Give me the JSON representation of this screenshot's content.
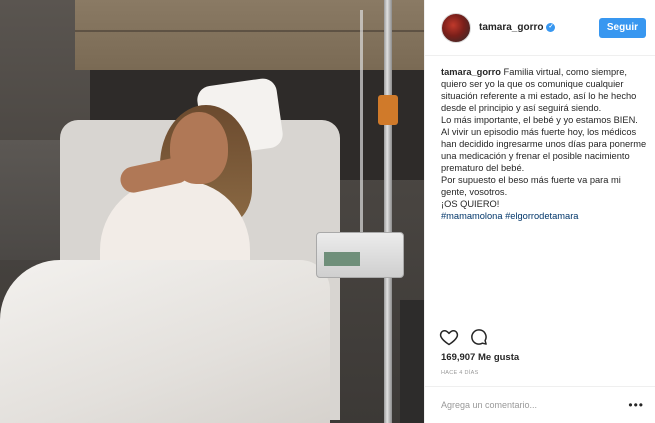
{
  "post": {
    "username": "tamara_gorro",
    "follow_label": "Seguir",
    "caption": {
      "username": "tamara_gorro",
      "text_1": "Familia virtual, como siempre, quiero ser yo la que os comunique cualquier situación referente a mi estado, así lo he hecho desde el principio y así seguirá siendo.",
      "text_2": "Lo más importante, el bebé y yo estamos BIEN.",
      "text_3": "Al vivir un episodio más fuerte hoy, los médicos han decidido ingresarme unos días para ponerme una medicación y frenar el posible nacimiento prematuro del bebé.",
      "text_4": "Por supuesto el beso más fuerte va para mi gente, vosotros.",
      "text_5": "¡OS QUIERO!",
      "hashtags": "#mamamolona #elgorrodetamara"
    },
    "likes_text": "169,907 Me gusta",
    "time_text": "HACE 4 DÍAS",
    "comment_placeholder": "Agrega un comentario...",
    "more_label": "•••"
  },
  "colors": {
    "accent": "#3897f0",
    "hashtag": "#003569",
    "muted": "#999999"
  },
  "icons": [
    "verified-badge-icon",
    "heart-icon",
    "comment-icon",
    "more-options-icon"
  ]
}
